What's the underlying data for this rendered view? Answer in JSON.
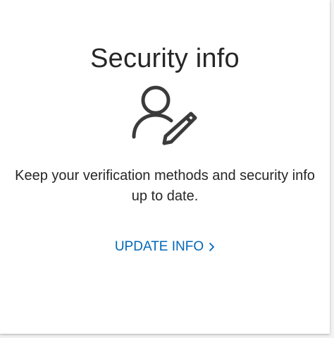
{
  "card": {
    "title": "Security info",
    "icon": "user-edit-icon",
    "description": "Keep your verification methods and security info up to date.",
    "link": {
      "label": "UPDATE INFO",
      "icon": "chevron-right-icon",
      "color": "#0067b8"
    }
  }
}
